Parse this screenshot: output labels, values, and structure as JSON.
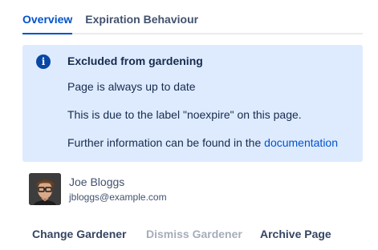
{
  "tabs": [
    {
      "label": "Overview",
      "active": true
    },
    {
      "label": "Expiration Behaviour",
      "active": false
    }
  ],
  "notice": {
    "icon": "info-icon",
    "title": "Excluded from gardening",
    "line1": "Page is always up to date",
    "line2": "This is due to the label \"noexpire\" on this page.",
    "line3_prefix": "Further information can be found in the ",
    "line3_link": "documentation"
  },
  "user": {
    "name": "Joe Bloggs",
    "email": "jbloggs@example.com"
  },
  "actions": {
    "change": "Change Gardener",
    "dismiss": "Dismiss Gardener",
    "archive": "Archive Page"
  },
  "colors": {
    "accent": "#0052cc",
    "panel_bg": "#deebff",
    "disabled": "#a5adba"
  }
}
